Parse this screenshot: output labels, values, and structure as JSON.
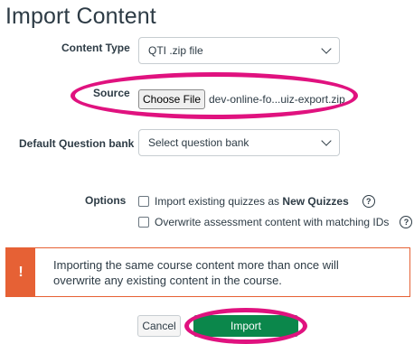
{
  "page": {
    "title": "Import Content"
  },
  "form": {
    "content_type": {
      "label": "Content Type",
      "value": "QTI .zip file"
    },
    "source": {
      "label": "Source",
      "button_label": "Choose File",
      "file_name": "dev-online-fo...uiz-export.zip"
    },
    "question_bank": {
      "label": "Default Question bank",
      "value": "Select question bank"
    },
    "options": {
      "label": "Options",
      "items": [
        {
          "prefix": "Import existing quizzes as ",
          "bold": "New Quizzes",
          "checked": false,
          "help_icon": "?"
        },
        {
          "prefix": "Overwrite assessment content with matching IDs",
          "bold": "",
          "checked": false,
          "help_icon": "?"
        }
      ]
    }
  },
  "alert": {
    "icon": "!",
    "line1": "Importing the same course content more than once will",
    "line2": "overwrite any existing content in the course."
  },
  "actions": {
    "cancel_label": "Cancel",
    "import_label": "Import"
  },
  "annotations": {
    "highlight_color": "#e0127f"
  }
}
